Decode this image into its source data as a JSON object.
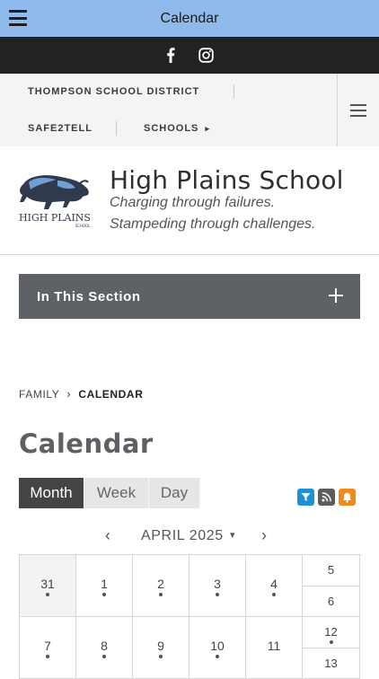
{
  "appbar": {
    "title": "Calendar",
    "menu_icon": "hamburger-menu-icon"
  },
  "social": {
    "icons": [
      "facebook-icon",
      "instagram-icon"
    ]
  },
  "topnav": {
    "items": [
      "THOMPSON SCHOOL DISTRICT",
      "SAFE2TELL",
      "SCHOOLS"
    ],
    "schools_caret": "▸",
    "menu_icon": "hamburger-menu-icon"
  },
  "header": {
    "logo_text_main": "HIGH PLAINS",
    "logo_text_sub": "SCHOOL",
    "school_name": "High Plains School",
    "tagline_line1": "Charging through failures.",
    "tagline_line2": "Stampeding through challenges."
  },
  "section": {
    "label": "In This Section",
    "toggle_icon": "plus-icon"
  },
  "breadcrumb": {
    "parent": "FAMILY",
    "separator": "›",
    "current": "CALENDAR"
  },
  "page_title": "Calendar",
  "view_tabs": [
    {
      "label": "Month",
      "active": true
    },
    {
      "label": "Week",
      "active": false
    },
    {
      "label": "Day",
      "active": false
    }
  ],
  "calendar_icons": [
    {
      "name": "filter-icon",
      "color": "#1f8fd8"
    },
    {
      "name": "rss-icon",
      "color": "#5c5c5c"
    },
    {
      "name": "bell-icon",
      "color": "#ef8a1f"
    }
  ],
  "month_nav": {
    "prev": "‹",
    "next": "›",
    "label": "APRIL 2025",
    "caret": "▾"
  },
  "weeks": [
    {
      "days": [
        {
          "num": "31",
          "dot": true,
          "prev_month": true
        },
        {
          "num": "1",
          "dot": true
        },
        {
          "num": "2",
          "dot": true
        },
        {
          "num": "3",
          "dot": true
        },
        {
          "num": "4",
          "dot": true
        }
      ],
      "weekend": [
        {
          "num": "5",
          "dot": false
        },
        {
          "num": "6",
          "dot": false
        }
      ]
    },
    {
      "days": [
        {
          "num": "7",
          "dot": true
        },
        {
          "num": "8",
          "dot": true
        },
        {
          "num": "9",
          "dot": true
        },
        {
          "num": "10",
          "dot": true
        },
        {
          "num": "11",
          "dot": false
        }
      ],
      "weekend": [
        {
          "num": "12",
          "dot": true
        },
        {
          "num": "13",
          "dot": false
        }
      ]
    }
  ]
}
